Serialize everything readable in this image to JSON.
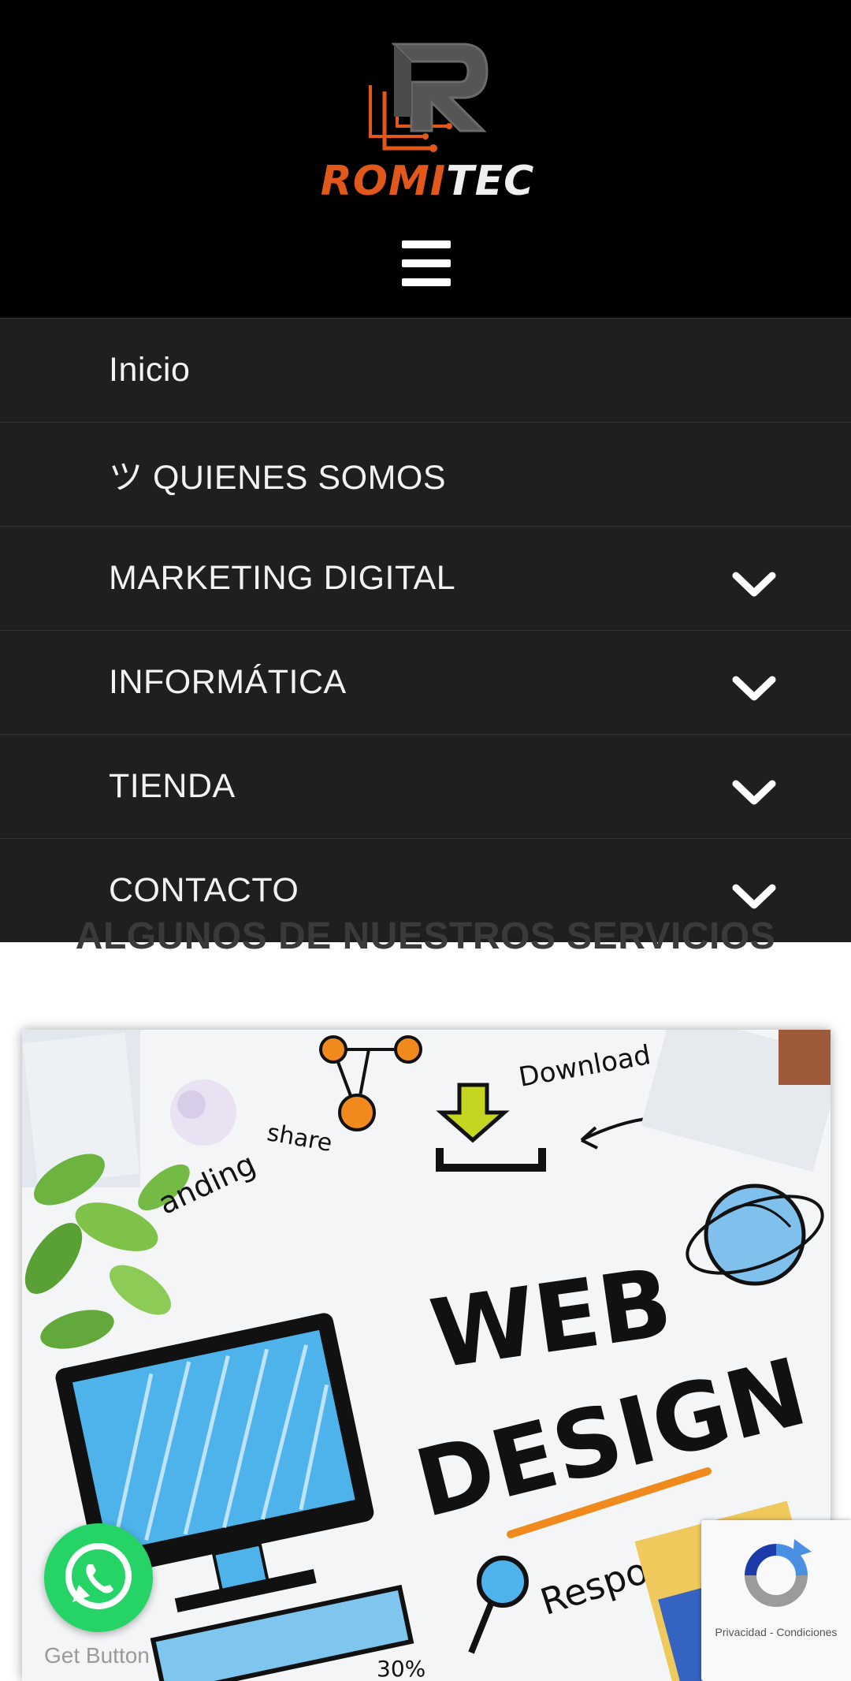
{
  "header": {
    "logo_text_accent": "ROMI",
    "logo_text_main": "TEC",
    "menu_icon": "hamburger-icon"
  },
  "menu": {
    "items": [
      {
        "label": "Inicio",
        "has_submenu": false
      },
      {
        "label": "ツ QUIENES SOMOS",
        "has_submenu": false
      },
      {
        "label": "MARKETING DIGITAL",
        "has_submenu": true
      },
      {
        "label": "INFORMÁTICA",
        "has_submenu": true
      },
      {
        "label": "TIENDA",
        "has_submenu": true
      },
      {
        "label": "CONTACTO",
        "has_submenu": true
      }
    ]
  },
  "main": {
    "section_title": "ALGUNOS DE NUESTROS SERVICIOS",
    "card_image": {
      "word1": "WEB",
      "word2": "DESIGN",
      "word3": "Responsive",
      "word4": "Download",
      "word5": "share",
      "word6": "anding",
      "word7": "30%"
    }
  },
  "widgets": {
    "whatsapp_caption": "Get Button",
    "whatsapp_icon": "whatsapp-icon",
    "recaptcha_privacy": "Privacidad",
    "recaptcha_separator": "-",
    "recaptcha_terms": "Condiciones"
  },
  "colors": {
    "header_bg": "#000000",
    "menu_bg": "#1f1f1f",
    "brand_orange": "#e2581a",
    "whatsapp_green": "#25d366"
  }
}
